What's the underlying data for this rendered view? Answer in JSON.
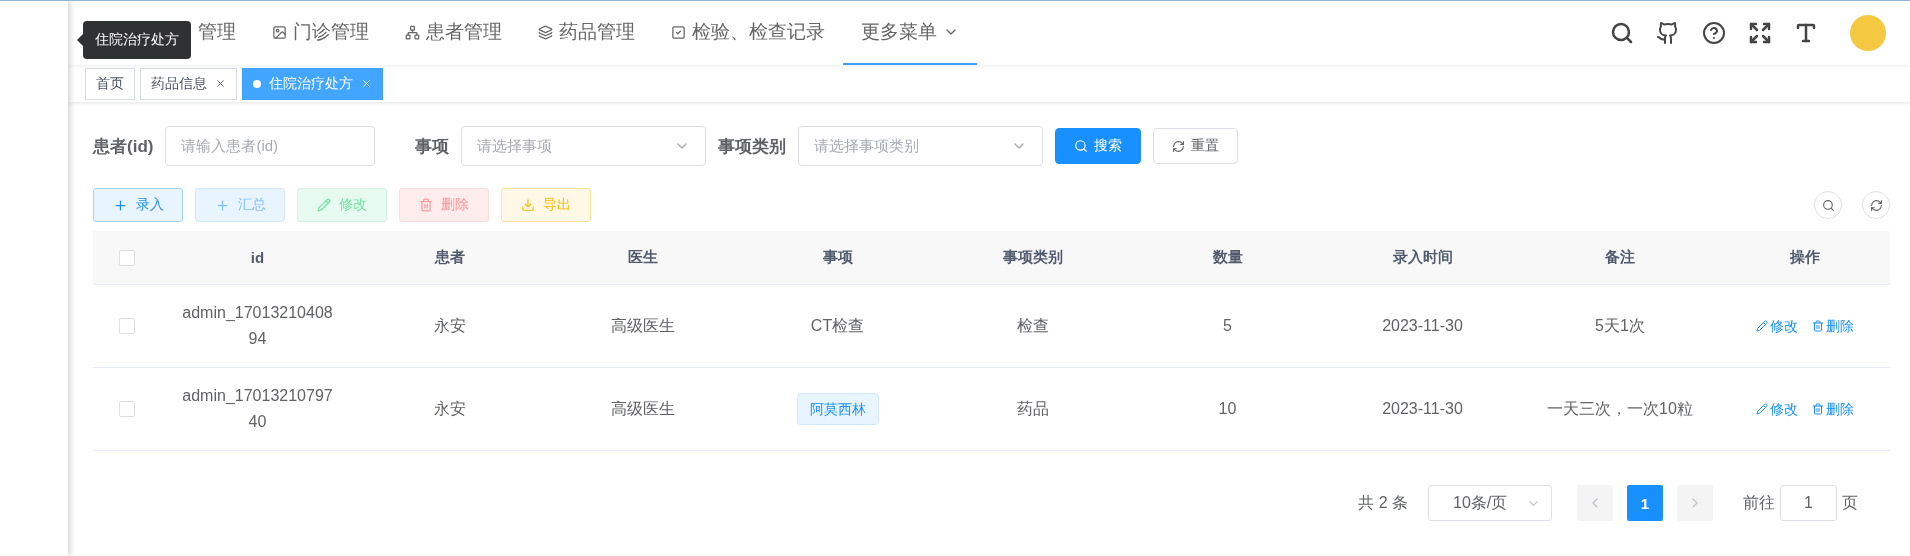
{
  "nav": {
    "items": [
      {
        "label": "管理",
        "kind": "link",
        "selected": false
      },
      {
        "label": "门诊管理",
        "kind": "link",
        "selected": false
      },
      {
        "label": "患者管理",
        "kind": "link",
        "selected": false
      },
      {
        "label": "药品管理",
        "kind": "link",
        "selected": false
      },
      {
        "label": "检验、检查记录",
        "kind": "link",
        "selected": false
      },
      {
        "label": "更多菜单",
        "kind": "dropdown",
        "selected": true
      }
    ],
    "tooltip": "住院治疗处方"
  },
  "tabs": [
    {
      "label": "首页",
      "closable": false,
      "selected": false
    },
    {
      "label": "药品信息",
      "closable": true,
      "selected": false
    },
    {
      "label": "住院治疗处方",
      "closable": true,
      "selected": true
    }
  ],
  "filters": [
    {
      "label": "患者(id)",
      "placeholder": "请输入患者(id)",
      "kind": "input"
    },
    {
      "label": "事项",
      "placeholder": "请选择事项",
      "kind": "select"
    },
    {
      "label": "事项类别",
      "placeholder": "请选择事项类别",
      "kind": "select"
    }
  ],
  "search_button": "搜索",
  "reset_button": "重置",
  "actions": [
    {
      "label": "录入",
      "kind": "add"
    },
    {
      "label": "汇总",
      "kind": "summary"
    },
    {
      "label": "修改",
      "kind": "edit"
    },
    {
      "label": "删除",
      "kind": "delete"
    },
    {
      "label": "导出",
      "kind": "export"
    }
  ],
  "table": {
    "all_checked": false,
    "columns": [
      "id",
      "患者",
      "医生",
      "事项",
      "事项类别",
      "数量",
      "录入时间",
      "备注",
      "操作"
    ],
    "rows": [
      {
        "checked": false,
        "id": "admin_1701321040894",
        "patient": "永安",
        "doctor": "高级医生",
        "item": "CT检查",
        "item_tag": false,
        "category": "检查",
        "quantity": "5",
        "time": "2023-11-30",
        "note": "5天1次",
        "edit": "修改",
        "delete": "删除"
      },
      {
        "checked": false,
        "id": "admin_1701321079740",
        "patient": "永安",
        "doctor": "高级医生",
        "item": "阿莫西林",
        "item_tag": true,
        "category": "药品",
        "quantity": "10",
        "time": "2023-11-30",
        "note": "一天三次，一次10粒",
        "edit": "修改",
        "delete": "删除"
      }
    ]
  },
  "pagination": {
    "total": "共 2 条",
    "page_size": "10条/页",
    "pages": [
      {
        "label": "1",
        "selected": true
      }
    ],
    "goto_prefix": "前往",
    "goto_value": "1",
    "goto_suffix": "页"
  }
}
